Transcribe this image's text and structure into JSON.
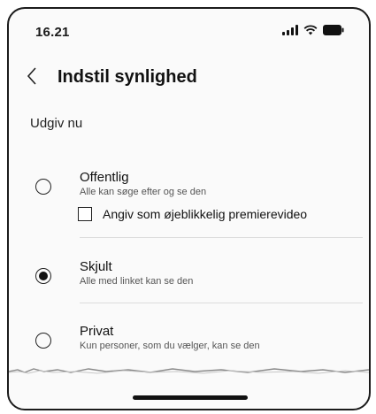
{
  "status_bar": {
    "time": "16.21",
    "icons": [
      "signal-icon",
      "wifi-icon",
      "battery-icon"
    ]
  },
  "header": {
    "back_icon": "chevron-left-icon",
    "title": "Indstil synlighed"
  },
  "section": {
    "label": "Udgiv nu"
  },
  "options": [
    {
      "title": "Offentlig",
      "subtitle": "Alle kan søge efter og se den",
      "selected": false
    },
    {
      "title": "Skjult",
      "subtitle": "Alle med linket kan se den",
      "selected": true
    },
    {
      "title": "Privat",
      "subtitle": "Kun personer, som du vælger, kan se den",
      "selected": false
    }
  ],
  "premiere_checkbox": {
    "label": "Angiv som øjeblikkelig premierevideo",
    "checked": false
  },
  "colors": {
    "background": "#fafafa",
    "text": "#111111",
    "divider": "#dcdcdc"
  }
}
